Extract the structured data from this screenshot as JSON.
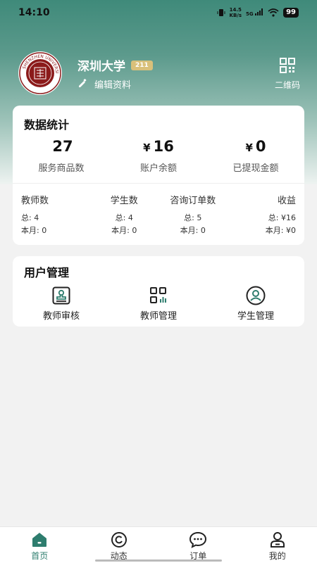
{
  "status_bar": {
    "time": "14:10",
    "net_speed_value": "14.5",
    "net_speed_unit": "KB/s",
    "signal_label": "5G",
    "battery": "99"
  },
  "profile": {
    "school_name": "深圳大学",
    "badge": "211",
    "edit_label": "编辑资料",
    "qrcode_label": "二维码"
  },
  "stats": {
    "title": "数据统计",
    "big": [
      {
        "prefix": "",
        "value": "27",
        "label": "服务商品数"
      },
      {
        "prefix": "¥",
        "value": "16",
        "label": "账户余额"
      },
      {
        "prefix": "¥",
        "value": "0",
        "label": "已提现金额"
      }
    ],
    "small": [
      {
        "title": "教师数",
        "total": "总: 4",
        "month": "本月: 0"
      },
      {
        "title": "学生数",
        "total": "总: 4",
        "month": "本月: 0"
      },
      {
        "title": "咨询订单数",
        "total": "总: 5",
        "month": "本月: 0"
      },
      {
        "title": "收益",
        "total": "总: ¥16",
        "month": "本月: ¥0"
      }
    ]
  },
  "user_management": {
    "title": "用户管理",
    "items": [
      {
        "label": "教师审核",
        "icon": "stamp-icon"
      },
      {
        "label": "教师管理",
        "icon": "grid-chart-icon"
      },
      {
        "label": "学生管理",
        "icon": "user-circle-icon"
      }
    ]
  },
  "tabbar": {
    "items": [
      {
        "label": "首页",
        "icon": "home-icon",
        "active": true
      },
      {
        "label": "动态",
        "icon": "moments-icon",
        "active": false
      },
      {
        "label": "订单",
        "icon": "chat-icon",
        "active": false
      },
      {
        "label": "我的",
        "icon": "profile-icon",
        "active": false
      }
    ]
  },
  "colors": {
    "accent": "#2e7d6e",
    "header_top": "#3f8a7a",
    "badge": "#d9c07a",
    "university_red": "#8b1a1a"
  }
}
